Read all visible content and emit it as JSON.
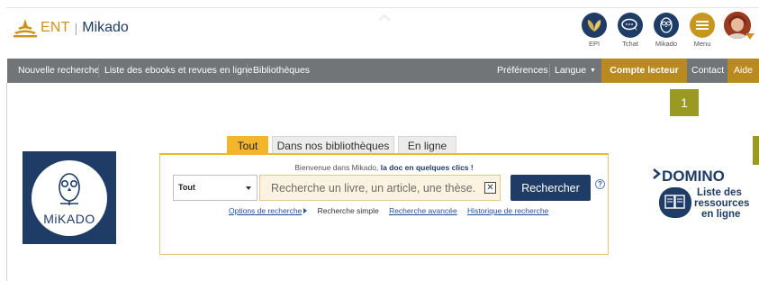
{
  "header": {
    "brand_ent": "ENT",
    "brand_sep": "|",
    "brand_mikado": "Mikado",
    "icons": [
      {
        "label": "EPI",
        "icon": "leaf-icon",
        "color": "#1f3c66"
      },
      {
        "label": "Tchat",
        "icon": "chat-icon",
        "color": "#1f3c66"
      },
      {
        "label": "Mikado",
        "icon": "owl-icon",
        "color": "#1f3c66"
      },
      {
        "label": "Menu",
        "icon": "menu-icon",
        "color": "#c8961e"
      }
    ]
  },
  "nav": {
    "items_left": [
      "Nouvelle recherche",
      "Liste des ebooks et revues en ligne",
      "Bibliothèques"
    ],
    "preferences": "Préférences",
    "langue": "Langue",
    "compte": "Compte lecteur",
    "contact": "Contact",
    "aide": "Aide"
  },
  "badge": "1",
  "mikado_logo_text": "MiKADO",
  "search": {
    "tabs": [
      "Tout",
      "Dans nos bibliothèques",
      "En ligne"
    ],
    "welcome_prefix": "Bienvenue dans Mikado,",
    "welcome_bold": "la doc en quelques clics !",
    "select_value": "Tout",
    "placeholder": "Recherche un livre, un article, une thèse...",
    "button": "Rechercher",
    "help": "?",
    "options": "Options de recherche",
    "simple": "Recherche simple",
    "avancee": "Recherche avancée",
    "historique": "Historique de recherche"
  },
  "domino": {
    "title": "DOMINO",
    "line1": "Liste des",
    "line2": "ressources",
    "line3": "en ligne"
  },
  "colors": {
    "navy": "#1f3c66",
    "gold": "#c8961e",
    "nav_bg": "#727577",
    "accent_gold": "#b98a1f",
    "tab_active": "#f3b52b"
  }
}
